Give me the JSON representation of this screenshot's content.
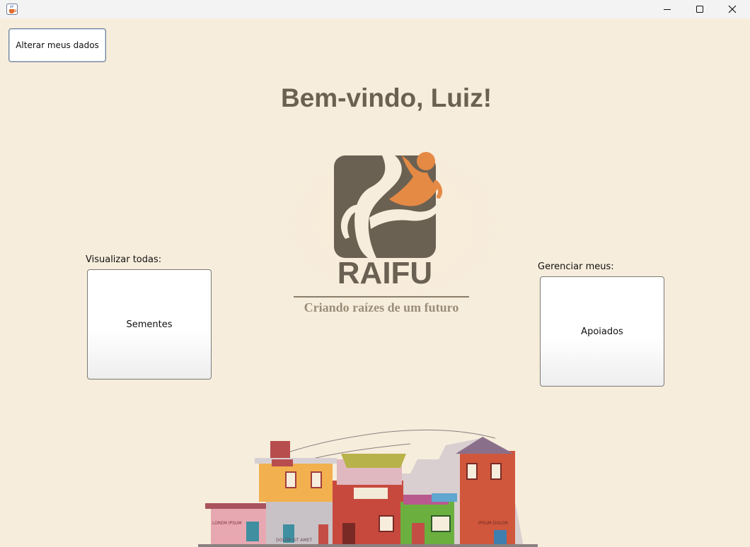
{
  "window": {
    "icon": "java-cup-icon",
    "controls": [
      "minimize-icon",
      "maximize-icon",
      "close-icon"
    ]
  },
  "header": {
    "edit_button_label": "Alterar meus dados",
    "welcome_text": "Bem-vindo, Luiz!"
  },
  "logo": {
    "name": "RAIFU",
    "tagline": "Criando raízes de um futuro",
    "colors": {
      "dark": "#6b6153",
      "orange": "#e58a45"
    }
  },
  "left_panel": {
    "label": "Visualizar todas:",
    "button_label": "Sementes"
  },
  "right_panel": {
    "label": "Gerenciar meus:",
    "button_label": "Apoiados"
  },
  "illustration": {
    "name": "favela-houses-illustration",
    "wall_signs": [
      "LOREM IPSUM",
      "DOLOR SIT AMET",
      "IPSUM DOLOR"
    ]
  },
  "colors": {
    "background": "#f7eddc",
    "title_text": "#6a6152"
  }
}
